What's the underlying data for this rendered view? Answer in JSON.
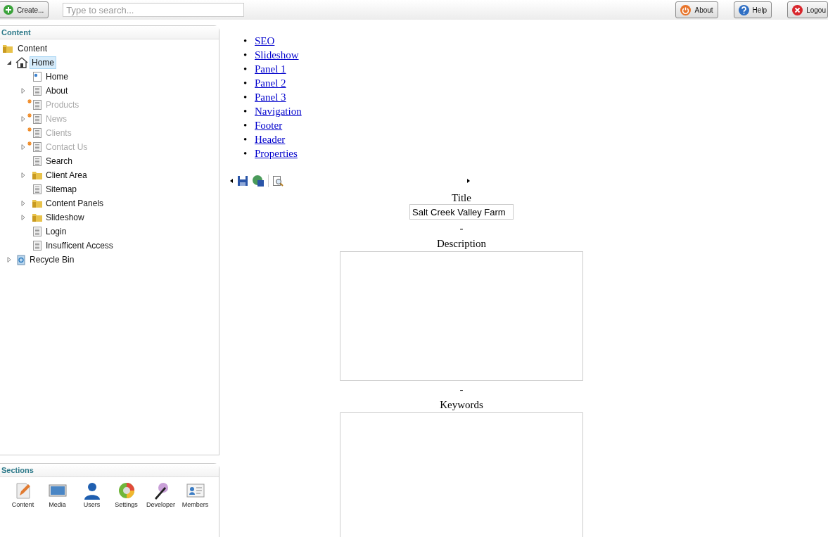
{
  "topbar": {
    "create_button": "Create...",
    "search": {
      "placeholder": "Type to search..."
    },
    "buttons": [
      {
        "label": "About",
        "kind": "about"
      },
      {
        "label": "Help",
        "kind": "help"
      },
      {
        "label": "Logou",
        "kind": "logout"
      }
    ]
  },
  "tree_panel": {
    "title": "Content",
    "root": {
      "label": "Content",
      "kind": "folder",
      "children": [
        {
          "label": "Home",
          "kind": "home",
          "expandable": true,
          "expanded": true,
          "selected": true,
          "published": true,
          "children": [
            {
              "label": "Home",
              "kind": "doc",
              "expandable": false,
              "expanded": false,
              "selected": false,
              "published": true
            },
            {
              "label": "About",
              "kind": "page",
              "expandable": true,
              "expanded": false,
              "selected": false,
              "published": true
            },
            {
              "label": "Products",
              "kind": "page",
              "expandable": false,
              "expanded": false,
              "selected": false,
              "published": false
            },
            {
              "label": "News",
              "kind": "page",
              "expandable": true,
              "expanded": false,
              "selected": false,
              "published": false
            },
            {
              "label": "Clients",
              "kind": "page",
              "expandable": false,
              "expanded": false,
              "selected": false,
              "published": false
            },
            {
              "label": "Contact Us",
              "kind": "page",
              "expandable": true,
              "expanded": false,
              "selected": false,
              "published": false
            },
            {
              "label": "Search",
              "kind": "page",
              "expandable": false,
              "expanded": false,
              "selected": false,
              "published": true
            },
            {
              "label": "Client Area",
              "kind": "folder",
              "expandable": true,
              "expanded": false,
              "selected": false,
              "published": true
            },
            {
              "label": "Sitemap",
              "kind": "page",
              "expandable": false,
              "expanded": false,
              "selected": false,
              "published": true
            },
            {
              "label": "Content Panels",
              "kind": "folder",
              "expandable": true,
              "expanded": false,
              "selected": false,
              "published": true
            },
            {
              "label": "Slideshow",
              "kind": "folder",
              "expandable": true,
              "expanded": false,
              "selected": false,
              "published": true
            },
            {
              "label": "Login",
              "kind": "page",
              "expandable": false,
              "expanded": false,
              "selected": false,
              "published": true
            },
            {
              "label": "Insufficent Access",
              "kind": "page",
              "expandable": false,
              "expanded": false,
              "selected": false,
              "published": true
            }
          ]
        },
        {
          "label": "Recycle Bin",
          "kind": "recycle",
          "expandable": true,
          "expanded": false,
          "selected": false,
          "published": true
        }
      ]
    }
  },
  "sections_panel": {
    "title": "Sections",
    "items": [
      {
        "label": "Content",
        "kind": "content"
      },
      {
        "label": "Media",
        "kind": "media"
      },
      {
        "label": "Users",
        "kind": "users"
      },
      {
        "label": "Settings",
        "kind": "settings"
      },
      {
        "label": "Developer",
        "kind": "developer"
      },
      {
        "label": "Members",
        "kind": "members"
      }
    ]
  },
  "tab_links": [
    {
      "bullet": "•",
      "label": "SEO"
    },
    {
      "bullet": "•",
      "label": "Slideshow"
    },
    {
      "bullet": "•",
      "label": "Panel 1"
    },
    {
      "bullet": "•",
      "label": "Panel 2"
    },
    {
      "bullet": "•",
      "label": "Panel 3"
    },
    {
      "bullet": "•",
      "label": "Navigation"
    },
    {
      "bullet": "•",
      "label": "Footer"
    },
    {
      "bullet": "•",
      "label": "Header"
    },
    {
      "bullet": "•",
      "label": "Properties"
    }
  ],
  "form": {
    "fields": [
      {
        "label": "Title",
        "kind": "text",
        "value": "Salt Creek Valley Farm",
        "separator": "-"
      },
      {
        "label": "Description",
        "kind": "textarea",
        "separator": "-"
      },
      {
        "label": "Keywords",
        "kind": "textarea"
      }
    ]
  }
}
